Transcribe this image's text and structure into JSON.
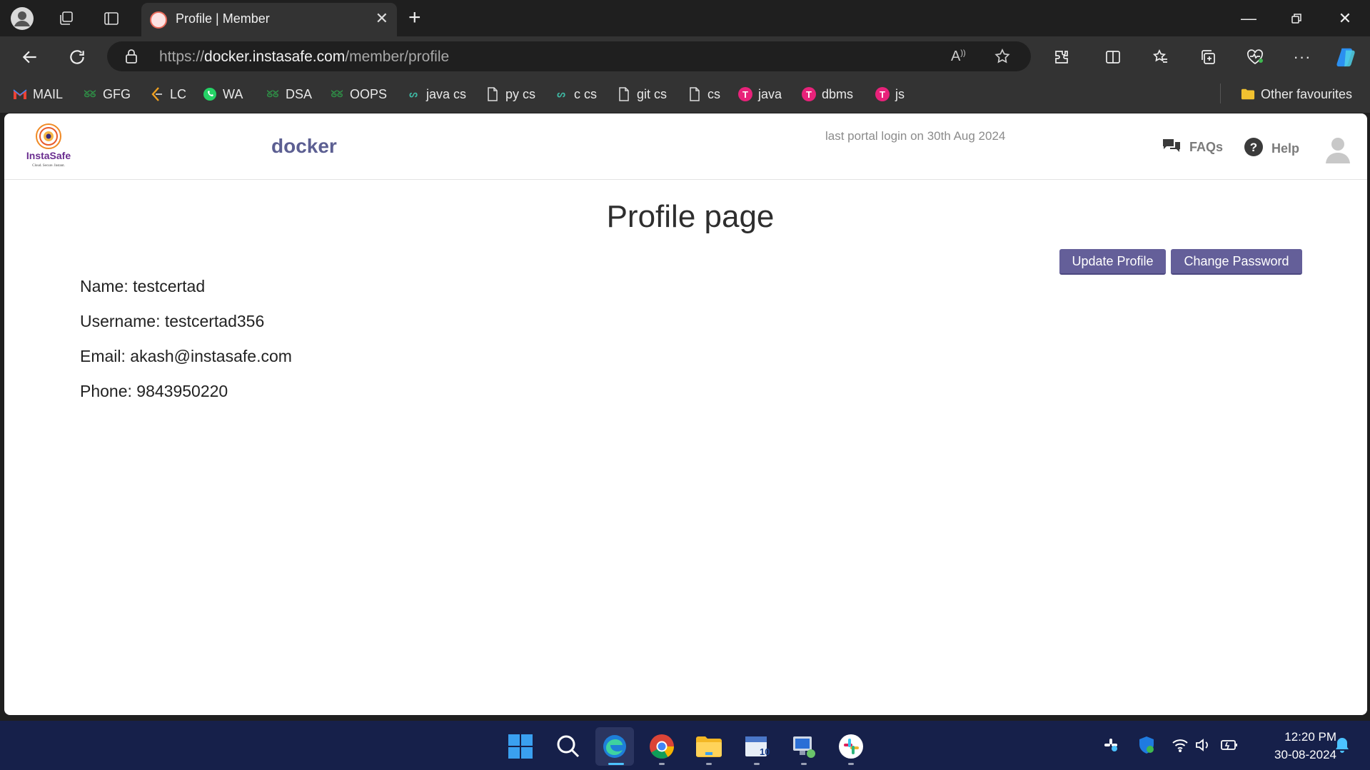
{
  "browser": {
    "tab_title": "Profile | Member",
    "url_prefix": "https://",
    "url_host": "docker.instasafe.com",
    "url_path": "/member/profile"
  },
  "bookmarks": [
    {
      "label": "MAIL",
      "icon": "gmail-icon"
    },
    {
      "label": "GFG",
      "icon": "gfg-icon"
    },
    {
      "label": "LC",
      "icon": "leetcode-icon"
    },
    {
      "label": "WA",
      "icon": "whatsapp-icon"
    },
    {
      "label": "DSA",
      "icon": "gfg-icon"
    },
    {
      "label": "OOPS",
      "icon": "gfg-icon"
    },
    {
      "label": "java cs",
      "icon": "codingninjas-icon"
    },
    {
      "label": "py cs",
      "icon": "page-icon"
    },
    {
      "label": "c cs",
      "icon": "codingninjas-icon"
    },
    {
      "label": "git cs",
      "icon": "page-icon"
    },
    {
      "label": "cs",
      "icon": "page-icon"
    },
    {
      "label": "java",
      "icon": "tpoint-icon"
    },
    {
      "label": "dbms",
      "icon": "tpoint-icon"
    },
    {
      "label": "js",
      "icon": "tpoint-icon"
    }
  ],
  "other_favourites": "Other favourites",
  "header": {
    "brand": "docker",
    "last_login": "last portal login on 30th Aug 2024",
    "faqs": "FAQs",
    "help": "Help",
    "logo_text": "InstaSafe",
    "logo_tagline": "Cloud. Secure. Instant."
  },
  "profile": {
    "heading": "Profile page",
    "update_button": "Update Profile",
    "change_password_button": "Change Password",
    "name": "Name: testcertad",
    "username": "Username: testcertad356",
    "email": "Email: akash@instasafe.com",
    "phone": "Phone: 9843950220"
  },
  "taskbar": {
    "time": "12:20 PM",
    "date": "30-08-2024"
  },
  "colors": {
    "accent": "#645f99",
    "brand_text": "#5c5f92",
    "taskbar": "#16204a"
  }
}
